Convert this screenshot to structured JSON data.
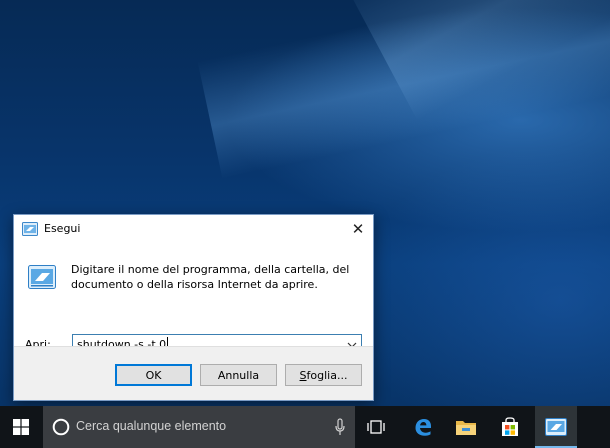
{
  "run_dialog": {
    "title": "Esegui",
    "close_symbol": "✕",
    "description": "Digitare il nome del programma, della cartella, del documento o della risorsa Internet da aprire.",
    "open_label_accel": "A",
    "open_label_rest": "pri:",
    "command_value": "shutdown -s -t 0",
    "ok_label": "OK",
    "cancel_label": "Annulla",
    "browse_label_accel": "S",
    "browse_label_rest": "foglia..."
  },
  "taskbar": {
    "search_placeholder": "Cerca qualunque elemento",
    "items": [
      {
        "name": "task-view",
        "icon": "task-view-icon"
      },
      {
        "name": "edge",
        "icon": "edge-icon"
      },
      {
        "name": "file-explorer",
        "icon": "folder-icon"
      },
      {
        "name": "store",
        "icon": "store-icon"
      },
      {
        "name": "run",
        "icon": "run-icon",
        "active": true
      }
    ]
  },
  "colors": {
    "accent": "#0078d7",
    "taskbar": "#101418",
    "search_box": "#3a3d41"
  }
}
